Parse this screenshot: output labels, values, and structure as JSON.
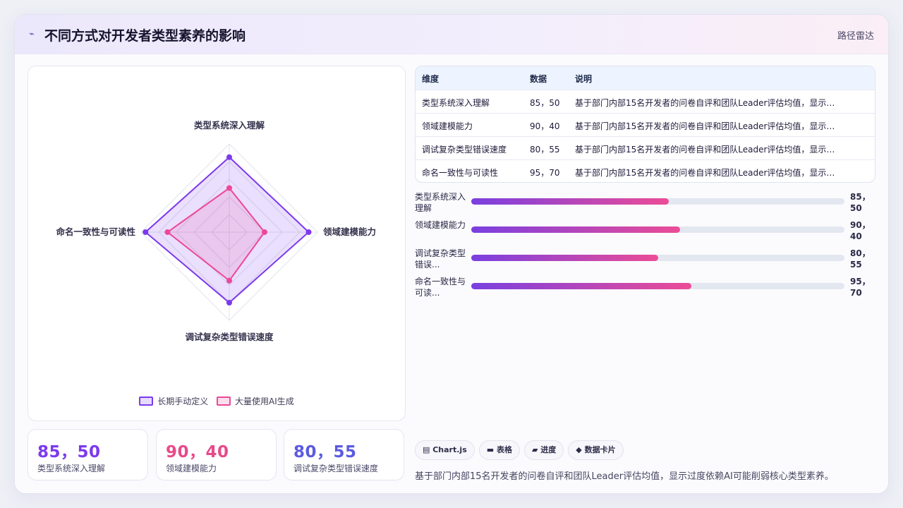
{
  "header": {
    "title": "不同方式对开发者类型素养的影响",
    "tag": "路径雷达",
    "icon": "sparkle-icon"
  },
  "colors": {
    "series_a": "#7c3aed",
    "series_b": "#ec4899",
    "stat_a": "#7c3aed",
    "stat_b": "#e84a8a",
    "stat_c": "#5b5be0"
  },
  "chart_data": {
    "type": "radar",
    "axes": [
      "类型系统深入理解",
      "领域建模能力",
      "调试复杂类型错误速度",
      "命名一致性与可读性"
    ],
    "rmax": 100,
    "series": [
      {
        "name": "长期手动定义",
        "values": [
          85,
          90,
          80,
          95
        ]
      },
      {
        "name": "大量使用AI生成",
        "values": [
          50,
          40,
          55,
          70
        ]
      }
    ],
    "legend_position": "bottom"
  },
  "stats": [
    {
      "value": "85，50",
      "label": "类型系统深入理解"
    },
    {
      "value": "90，40",
      "label": "领域建模能力"
    },
    {
      "value": "80，55",
      "label": "调试复杂类型错误速度"
    }
  ],
  "table": {
    "headers": [
      "维度",
      "数据",
      "说明"
    ],
    "rows": [
      [
        "类型系统深入理解",
        "85，50",
        "基于部门内部15名开发者的问卷自评和团队Leader评估均值，显示过..."
      ],
      [
        "领域建模能力",
        "90，40",
        "基于部门内部15名开发者的问卷自评和团队Leader评估均值，显示过..."
      ],
      [
        "调试复杂类型错误速度",
        "80，55",
        "基于部门内部15名开发者的问卷自评和团队Leader评估均值，显示过..."
      ],
      [
        "命名一致性与可读性",
        "95，70",
        "基于部门内部15名开发者的问卷自评和团队Leader评估均值，显示过..."
      ]
    ]
  },
  "progress": [
    {
      "label": "类型系统深入理解",
      "value": "85，50",
      "fill_pct": 53
    },
    {
      "label": "领域建模能力",
      "value": "90，40",
      "fill_pct": 56
    },
    {
      "label": "调试复杂类型错误...",
      "value": "80，55",
      "fill_pct": 50
    },
    {
      "label": "命名一致性与可读...",
      "value": "95，70",
      "fill_pct": 59
    }
  ],
  "tabs": [
    {
      "icon": "chart-icon",
      "label": "Chart.js"
    },
    {
      "icon": "table-icon",
      "label": "表格"
    },
    {
      "icon": "progress-icon",
      "label": "进度"
    },
    {
      "icon": "card-icon",
      "label": "数据卡片"
    }
  ],
  "note": "基于部门内部15名开发者的问卷自评和团队Leader评估均值，显示过度依赖AI可能削弱核心类型素养。"
}
